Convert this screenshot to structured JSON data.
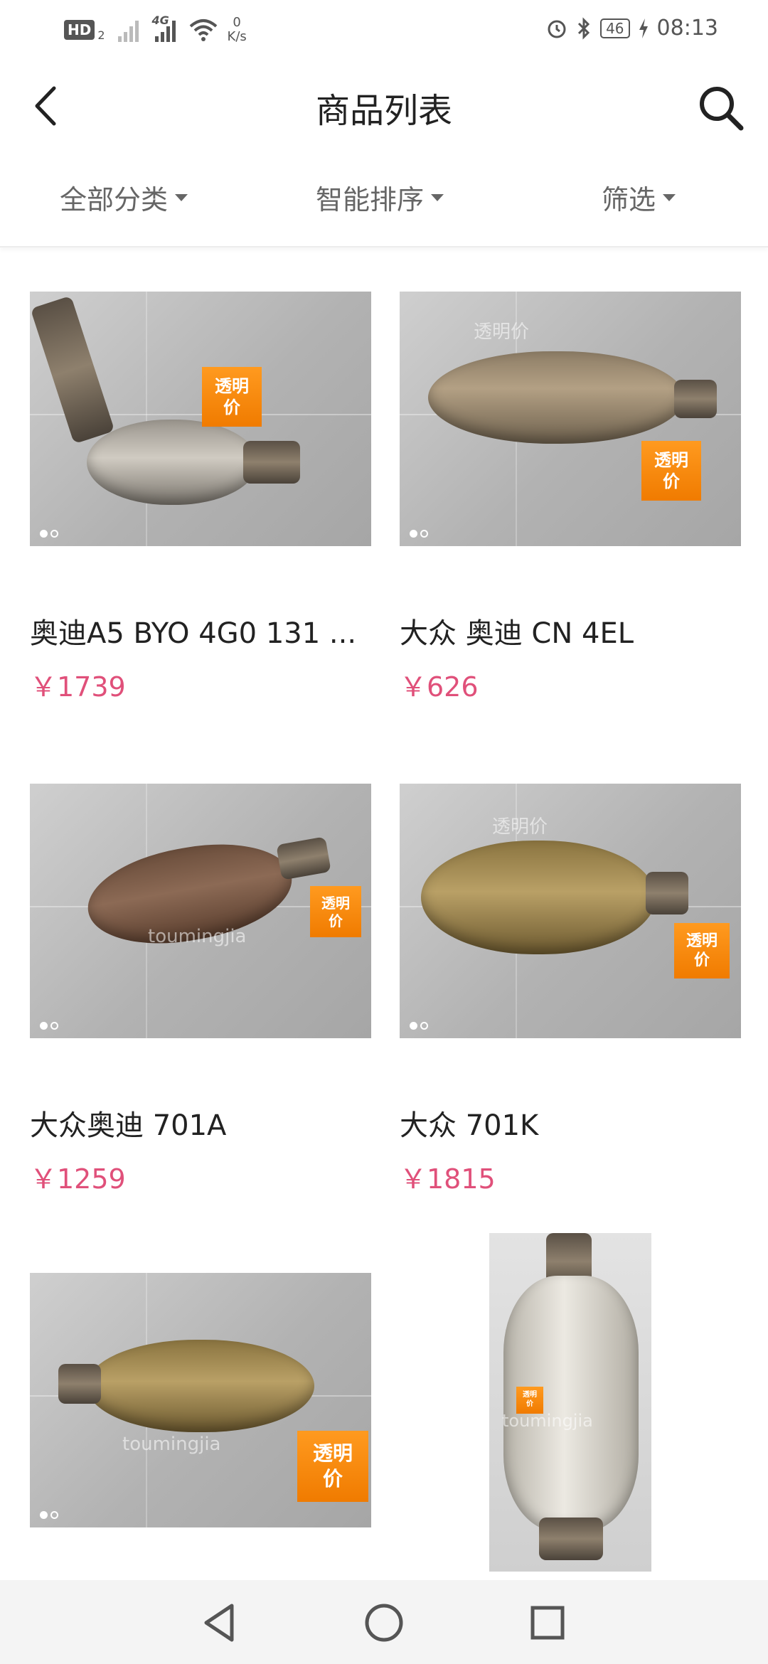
{
  "status_bar": {
    "hd": "HD",
    "hd_sub": "2",
    "network": "4G",
    "speed_value": "0",
    "speed_unit": "K/s",
    "battery": "46",
    "time": "08:13"
  },
  "header": {
    "title": "商品列表"
  },
  "filters": {
    "category": "全部分类",
    "sort": "智能排序",
    "filter": "筛选"
  },
  "products": [
    {
      "name": "奥迪A5 BYO 4G0 131 ...",
      "price": "￥1739",
      "badge": [
        "透明",
        "价"
      ]
    },
    {
      "name": "大众 奥迪 CN 4EL",
      "price": "￥626",
      "badge": [
        "透明",
        "价"
      ],
      "watermark": "透明价"
    },
    {
      "name": "大众奥迪 701A",
      "price": "￥1259",
      "badge": [
        "透明",
        "价"
      ],
      "watermark": "toumingjia"
    },
    {
      "name": "大众 701K",
      "price": "￥1815",
      "badge": [
        "透明",
        "价"
      ],
      "watermark": "透明价"
    },
    {
      "badge": [
        "透明",
        "价"
      ],
      "watermark": "toumingjia"
    },
    {
      "badge": [
        "透明",
        "价"
      ],
      "watermark": "toumingjia"
    }
  ],
  "colors": {
    "price": "#e0507a",
    "badge": "#f58a0a",
    "title": "#222222",
    "filter_text": "#666666"
  },
  "icons": {
    "back": "chevron-left-icon",
    "search": "search-icon",
    "nav_back": "triangle-back-icon",
    "nav_home": "circle-home-icon",
    "nav_recent": "square-recent-icon"
  }
}
